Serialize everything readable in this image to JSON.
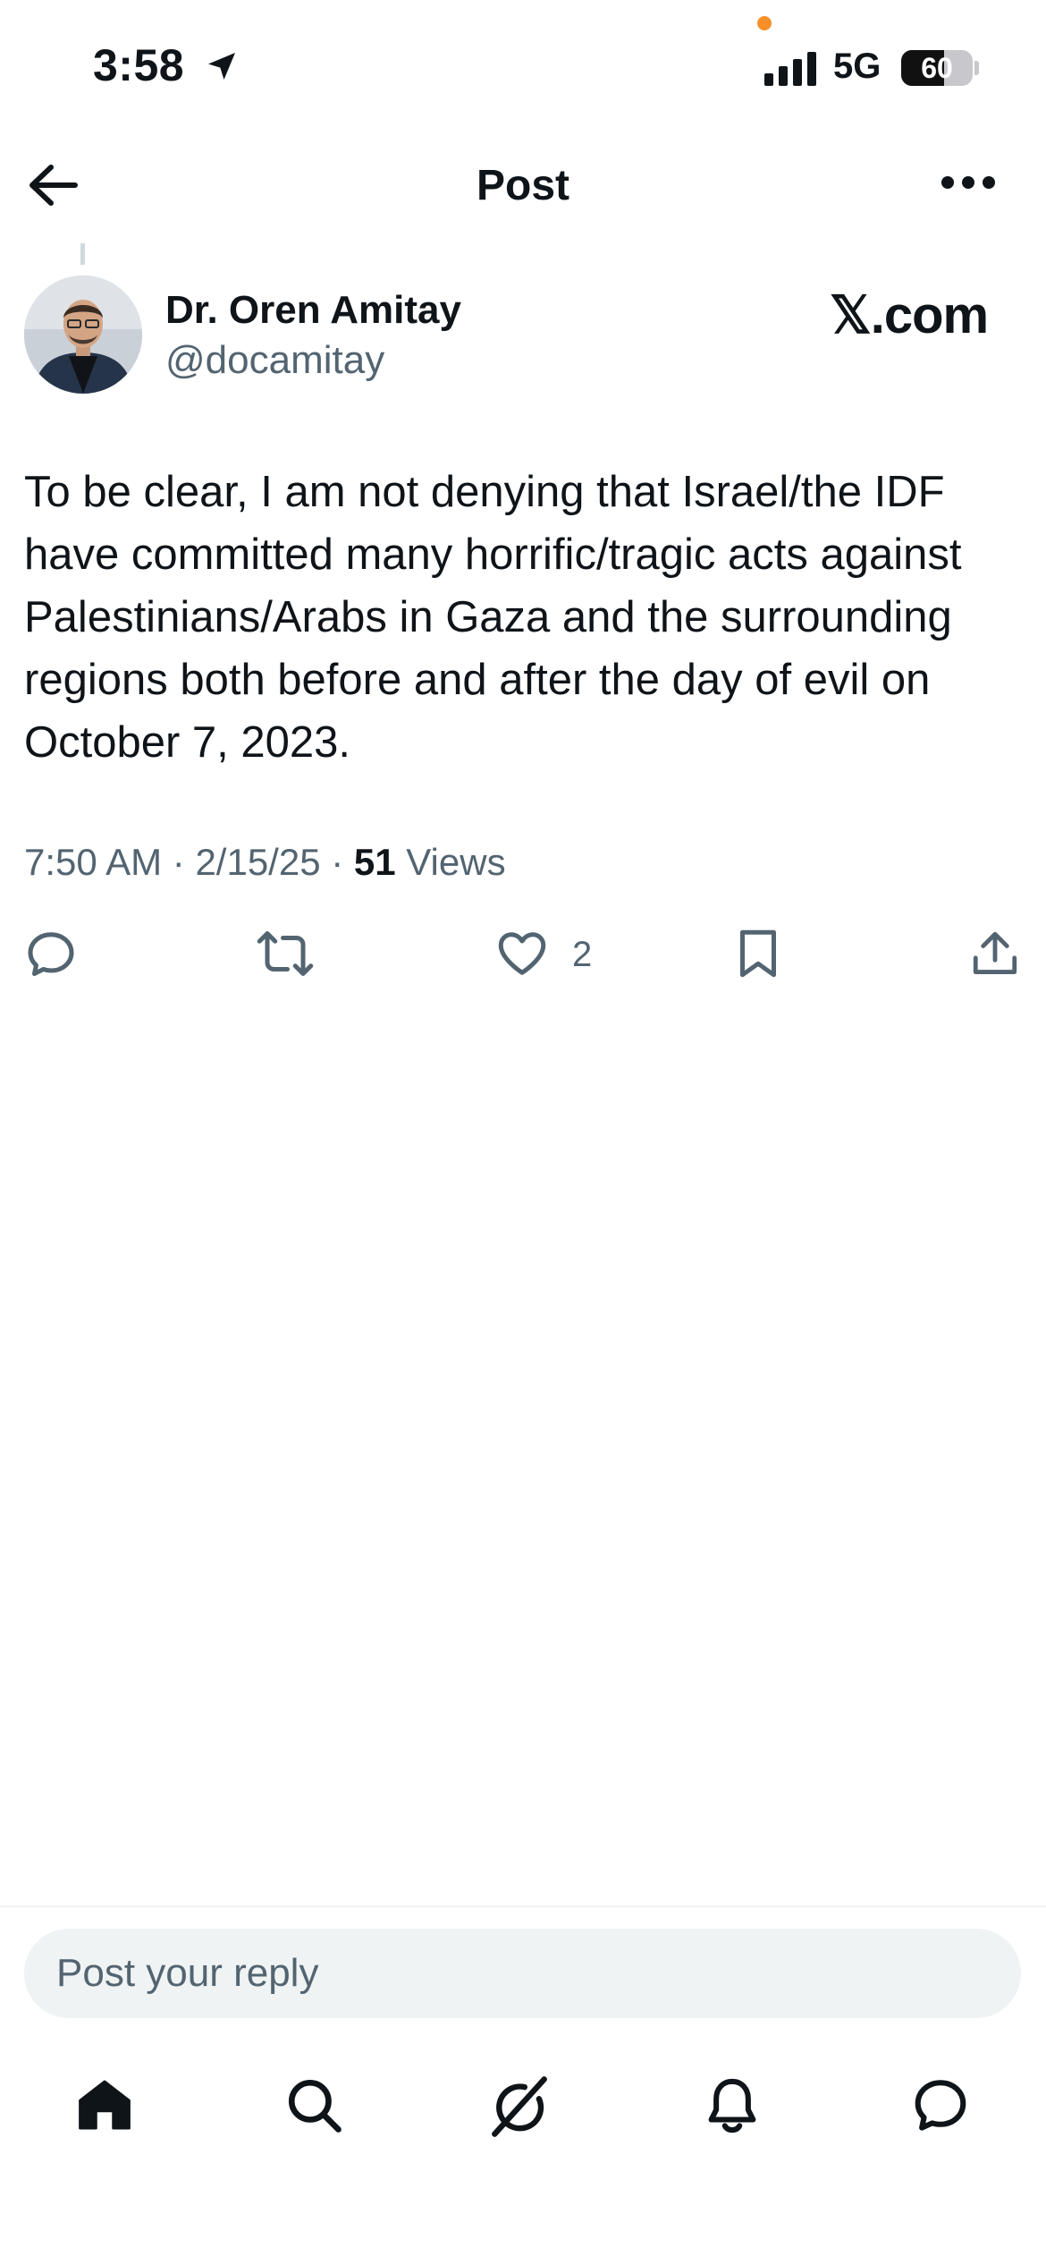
{
  "status_bar": {
    "time": "3:58",
    "network": "5G",
    "battery_level": "60",
    "battery_fraction": 0.6,
    "icons": [
      "location-arrow-icon",
      "signal-bars-icon",
      "battery-icon"
    ]
  },
  "header": {
    "title": "Post",
    "icons": [
      "back-arrow-icon",
      "more-horizontal-icon"
    ]
  },
  "post": {
    "author_name": "Dr. Oren Amitay",
    "author_handle": "@docamitay",
    "brand_text": "𝕏.com",
    "text": "To be clear, I am not denying that Israel/the IDF have committed many horrific/tragic acts against Palestinians/Arabs in Gaza and the surrounding regions both before and after the day of evil on October 7, 2023.",
    "time": "7:50 AM",
    "date": "2/15/25",
    "views_count": "51",
    "views_label": "Views",
    "separator": " · ",
    "like_count": "2"
  },
  "actions": [
    "reply-icon",
    "repost-icon",
    "like-icon",
    "bookmark-icon",
    "share-icon"
  ],
  "reply": {
    "placeholder": "Post your reply"
  },
  "bottom_nav": [
    "home-icon",
    "search-icon",
    "grok-icon",
    "notifications-bell-icon",
    "messages-icon"
  ],
  "colors": {
    "text_primary": "#0f1419",
    "text_secondary": "#536471",
    "reply_bg": "#eff3f4",
    "status_dot": "#f7902a"
  }
}
